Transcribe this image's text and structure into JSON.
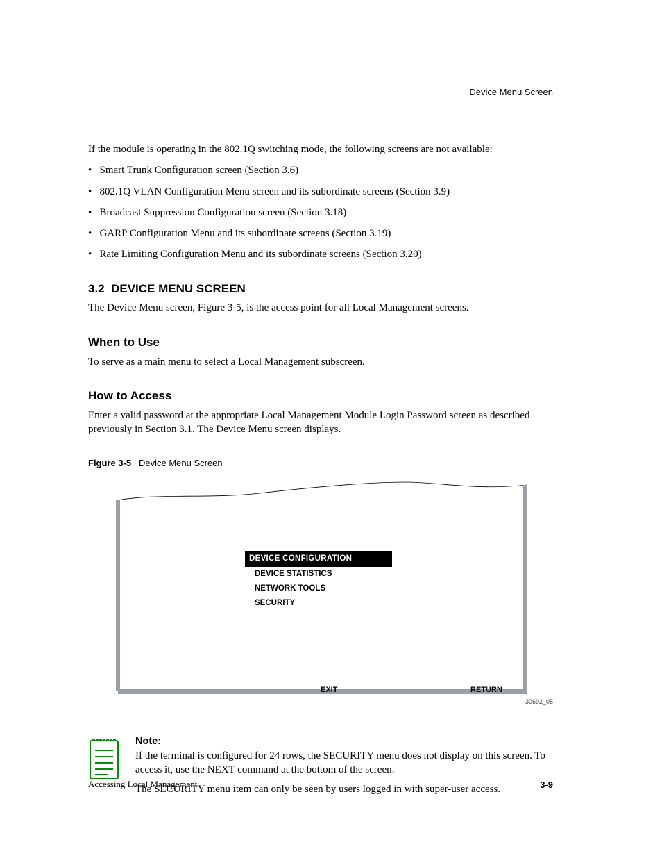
{
  "runningHeader": "Device Menu Screen",
  "intro": [
    "If the module is operating in the 802.1Q switching mode, the following screens are not available:",
    "Smart Trunk Configuration screen (Section 3.6)",
    "802.1Q VLAN Configuration Menu screen and its subordinate screens (Section 3.9)",
    "Broadcast Suppression Configuration screen (Section 3.18)",
    "GARP Configuration Menu and its subordinate screens (Section 3.19)",
    "Rate Limiting Configuration Menu and its subordinate screens (Section 3.20)"
  ],
  "section": {
    "number": "3.2",
    "title": "DEVICE MENU SCREEN"
  },
  "sectionIntro": "The Device Menu screen, Figure 3-5, is the access point for all Local Management screens.",
  "whenToUse": {
    "h": "When to Use",
    "p": "To serve as a main menu to select a Local Management subscreen."
  },
  "howToAccess": {
    "h": "How to Access",
    "p": "Enter a valid password at the appropriate Local Management Module Login Password screen as described previously in Section 3.1. The Device Menu screen displays."
  },
  "figure": {
    "label": "Figure 3-5",
    "caption": "Device Menu Screen",
    "menu": {
      "selected": "DEVICE  CONFIGURATION",
      "items": [
        "DEVICE STATISTICS",
        "NETWORK TOOLS",
        "SECURITY"
      ]
    },
    "exit": "EXIT",
    "return": "RETURN",
    "id": "30692_05"
  },
  "note": {
    "label": "Note:",
    "items": [
      "If the terminal is configured for 24 rows, the SECURITY menu does not display on this screen. To access it, use the NEXT command at the bottom of the screen.",
      "The SECURITY menu item can only be seen by users logged in with super-user access."
    ]
  },
  "footer": {
    "left": "Accessing Local Management",
    "right": "3-9"
  },
  "bullet": "•"
}
